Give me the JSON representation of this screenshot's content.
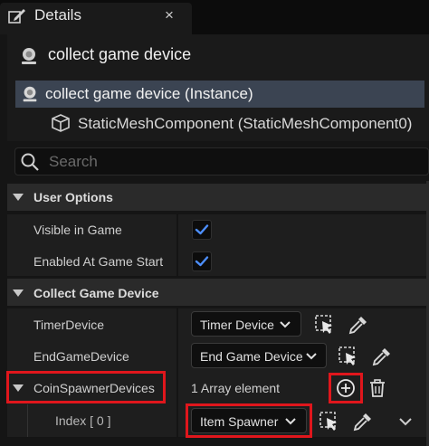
{
  "tab": {
    "title": "Details",
    "close_glyph": "×",
    "icon": "details-pencil-icon"
  },
  "actor": {
    "name": "collect game device",
    "icon": "actor-icon"
  },
  "components": [
    {
      "label": "collect game device (Instance)",
      "icon": "actor-icon",
      "selected": true
    },
    {
      "label": "StaticMeshComponent (StaticMeshComponent0)",
      "icon": "static-mesh-cube-icon",
      "selected": false
    }
  ],
  "search": {
    "placeholder": "Search",
    "value": ""
  },
  "sections": {
    "user_options": {
      "title": "User Options",
      "rows": [
        {
          "label": "Visible in Game",
          "checked": true
        },
        {
          "label": "Enabled At Game Start",
          "checked": true
        }
      ]
    },
    "collect_game_device": {
      "title": "Collect Game Device",
      "timer_device": {
        "label": "TimerDevice",
        "value": "Timer Device"
      },
      "end_game_device": {
        "label": "EndGameDevice",
        "value": "End Game Device"
      },
      "coin_spawner_devices": {
        "label": "CoinSpawnerDevices",
        "summary": "1 Array element"
      },
      "index_row": {
        "label": "Index",
        "index_text": "[ 0 ]",
        "value": "Item Spawner"
      }
    }
  },
  "colors": {
    "accent_check": "#4d8fff",
    "highlight_red": "#e0161c",
    "selected_row": "#3b4452",
    "panel_bg": "#1a1a1a"
  }
}
